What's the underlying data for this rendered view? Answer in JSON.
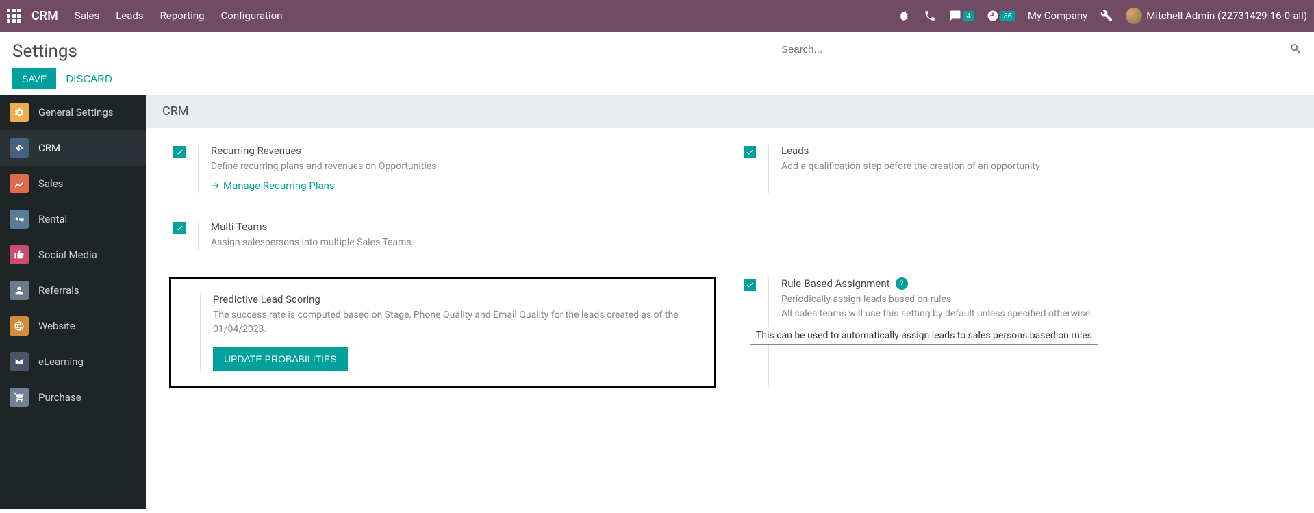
{
  "header": {
    "brand": "CRM",
    "nav": [
      "Sales",
      "Leads",
      "Reporting",
      "Configuration"
    ],
    "chat_badge": "4",
    "clock_badge": "36",
    "company": "My Company",
    "user": "Mitchell Admin (22731429-16-0-all)"
  },
  "page": {
    "title": "Settings",
    "save": "SAVE",
    "discard": "DISCARD",
    "search_placeholder": "Search...",
    "section": "CRM"
  },
  "sidebar": {
    "items": [
      {
        "label": "General Settings",
        "color": "#f0ad4e"
      },
      {
        "label": "CRM",
        "color": "#46627f"
      },
      {
        "label": "Sales",
        "color": "#e06c4f"
      },
      {
        "label": "Rental",
        "color": "#5b7c99"
      },
      {
        "label": "Social Media",
        "color": "#c94d6f"
      },
      {
        "label": "Referrals",
        "color": "#6b7a8f"
      },
      {
        "label": "Website",
        "color": "#d68b3a"
      },
      {
        "label": "eLearning",
        "color": "#4a5568"
      },
      {
        "label": "Purchase",
        "color": "#718096"
      }
    ]
  },
  "settings": {
    "recurring": {
      "title": "Recurring Revenues",
      "desc": "Define recurring plans and revenues on Opportunities",
      "link": "Manage Recurring Plans"
    },
    "leads": {
      "title": "Leads",
      "desc": "Add a qualification step before the creation of an opportunity"
    },
    "multi_teams": {
      "title": "Multi Teams",
      "desc": "Assign salespersons into multiple Sales Teams."
    },
    "predictive": {
      "title": "Predictive Lead Scoring",
      "desc": "The success rate is computed based on Stage, Phone Quality and Email Quality for the leads created as of the 01/04/2023.",
      "button": "UPDATE PROBABILITIES"
    },
    "rule_based": {
      "title": "Rule-Based Assignment",
      "desc1": "Periodically assign leads based on rules",
      "desc2": "All sales teams will use this setting by default unless specified otherwise.",
      "tooltip": "This can be used to automatically assign leads to sales persons based on rules"
    }
  }
}
